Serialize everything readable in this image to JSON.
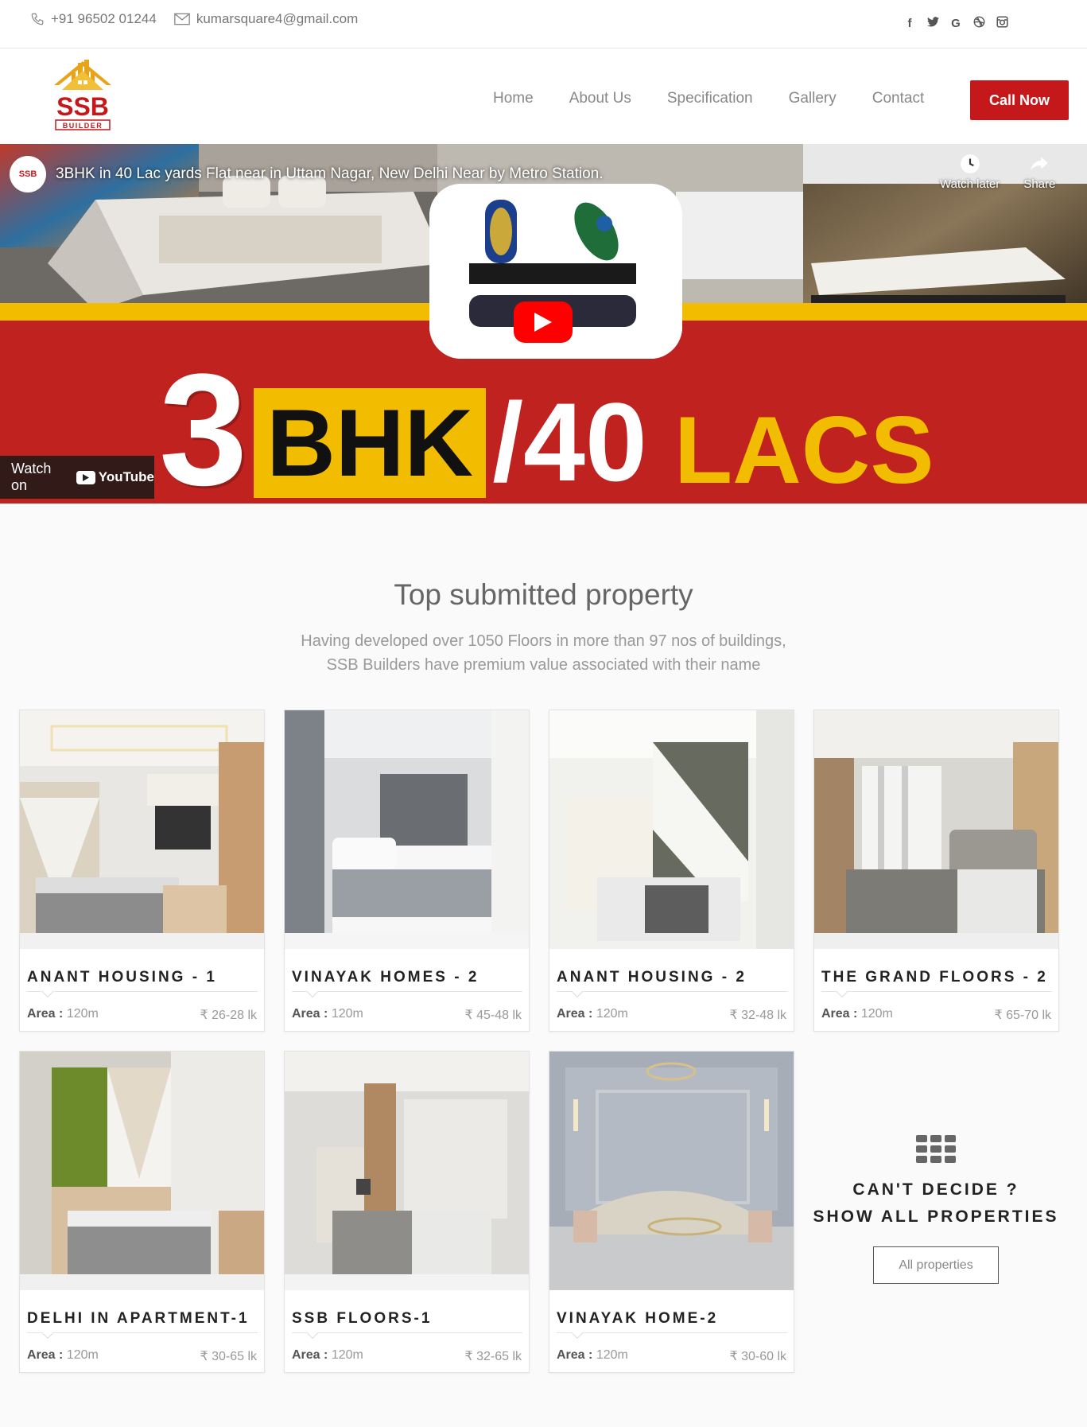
{
  "topbar": {
    "phone": "+91 96502 01244",
    "email": "kumarsquare4@gmail.com",
    "social": [
      {
        "icon": "facebook-icon",
        "glyph": "f"
      },
      {
        "icon": "twitter-icon",
        "glyph": "t"
      },
      {
        "icon": "google-icon",
        "glyph": "G"
      },
      {
        "icon": "dribbble-icon",
        "glyph": "⊕"
      },
      {
        "icon": "instagram-icon",
        "glyph": "◙"
      }
    ]
  },
  "header": {
    "logo_text": "SSB",
    "logo_sub": "BUILDER",
    "nav": [
      "Home",
      "About Us",
      "Specification",
      "Gallery",
      "Contact"
    ],
    "call_label": "Call Now"
  },
  "video": {
    "title": "3BHK in 40 Lac yards Flat near in Uttam Nagar, New Delhi Near by Metro Station.",
    "watch_later": "Watch later",
    "share": "Share",
    "watch_on": "Watch on",
    "youtube": "YouTube",
    "banner": {
      "num": "3",
      "bhk": "BHK",
      "slash": "/40",
      "lacs": "LACS"
    }
  },
  "section": {
    "title": "Top submitted property",
    "sub1": "Having developed over 1050 Floors in more than 97 nos of buildings,",
    "sub2": "SSB Builders have premium value associated with their name"
  },
  "properties": [
    {
      "name": "ANANT HOUSING - 1",
      "area_label": "Area :",
      "area": "120m",
      "price": "₹ 26-28 lk"
    },
    {
      "name": "VINAYAK HOMES - 2",
      "area_label": "Area :",
      "area": "120m",
      "price": "₹ 45-48 lk"
    },
    {
      "name": "ANANT HOUSING - 2",
      "area_label": "Area :",
      "area": "120m",
      "price": "₹ 32-48 lk"
    },
    {
      "name": "THE GRAND FLOORS - 2",
      "area_label": "Area :",
      "area": "120m",
      "price": "₹ 65-70 lk"
    },
    {
      "name": "DELHI IN APARTMENT-1",
      "area_label": "Area :",
      "area": "120m",
      "price": "₹ 30-65 lk"
    },
    {
      "name": "SSB FLOORS-1",
      "area_label": "Area :",
      "area": "120m",
      "price": "₹ 32-65 lk"
    },
    {
      "name": "VINAYAK HOME-2",
      "area_label": "Area :",
      "area": "120m",
      "price": "₹ 30-60 lk"
    }
  ],
  "cta": {
    "line1": "CAN'T DECIDE ?",
    "line2": "SHOW ALL PROPERTIES",
    "button": "All properties"
  },
  "colors": {
    "brand_red": "#c4181b",
    "banner_yellow": "#f2bd00"
  }
}
